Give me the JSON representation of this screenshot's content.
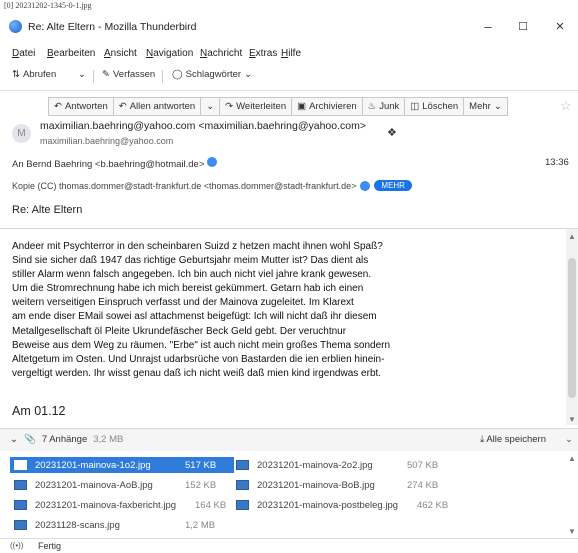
{
  "caption": "[0] 20231202-1345-0-1.jpg",
  "window": {
    "title": "Re: Alte Eltern - Mozilla Thunderbird",
    "min": "–",
    "max": "☐",
    "close": "✕"
  },
  "menu": [
    "Datei",
    "Bearbeiten",
    "Ansicht",
    "Navigation",
    "Nachricht",
    "Extras",
    "Hilfe"
  ],
  "toolbar": {
    "get": "Abrufen",
    "write": "Verfassen",
    "tags": "Schlagwörter"
  },
  "actions": {
    "reply": "Antworten",
    "reply_all": "Allen antworten",
    "forward": "Weiterleiten",
    "archive": "Archivieren",
    "junk": "Junk",
    "delete": "Löschen",
    "more": "Mehr"
  },
  "header": {
    "from": "maximilian.baehring@yahoo.com <maximilian.baehring@yahoo.com>",
    "from_sub": "maximilian.baehring@yahoo.com",
    "to": "An  Bernd Baehring <b.baehring@hotmail.de>",
    "time": "13:36",
    "cc": "Kopie (CC)  thomas.dommer@stadt-frankfurt.de <thomas.dommer@stadt-frankfurt.de>",
    "cc_more": "MEHR",
    "subject": "Re: Alte Eltern"
  },
  "body_lines": [
    "Andeer mit Psychterror in den scheinbaren Suizd z hetzen macht ihnen wohl Spaß?",
    "Sind sie sicher daß 1947 das richtige Geburtsjahr meim Mutter ist? Das dient als",
    "stiller Alarm wenn falsch angegeben. Ich bin auch nicht viel jahre krank gewesen.",
    "Um die Stromrechnung habe ich mich bereist gekümmert. Getarn hab ich einen",
    "weitern verseitigen Einspruch verfasst und der Mainova zugeleitet. Im Klarext",
    "am ende diser EMail sowei asl attachmenst beigefügt: Ich will nicht daß ihr diesem",
    "Metallgesellschaft öl Pleite Ukrundefäscher Beck Geld gebt. Der veruchtnur",
    "Beweise aus dem Weg zu räumen. \"Erbe\" ist auch nicht mein großes Thema sondern",
    "Altetgetum im Osten. Und Unrajst udarbsrüche von Bastarden die ien erblien hinein-",
    "vergeltigt werden. Ihr wisst genau daß ich nicht weiß daß mien kind irgendwas erbt."
  ],
  "am": "Am 01.12",
  "attachments_header": {
    "count": "7 Anhänge",
    "size": "3,2 MB",
    "save_all": "Alle speichern"
  },
  "attachments": [
    {
      "name": "20231201-mainova-1o2.jpg",
      "size": "517 KB"
    },
    {
      "name": "20231201-mainova-2o2.jpg",
      "size": "507 KB"
    },
    {
      "name": "20231201-mainova-AoB.jpg",
      "size": "152 KB"
    },
    {
      "name": "20231201-mainova-BoB.jpg",
      "size": "274 KB"
    },
    {
      "name": "20231201-mainova-faxbericht.jpg",
      "size": "164 KB"
    },
    {
      "name": "20231201-mainova-postbeleg.jpg",
      "size": "462 KB"
    },
    {
      "name": "20231128-scans.jpg",
      "size": "1,2 MB"
    }
  ],
  "status": "Fertig",
  "colors": {
    "accent": "#2f7bd9",
    "mehr_badge": "#1a73e8"
  }
}
